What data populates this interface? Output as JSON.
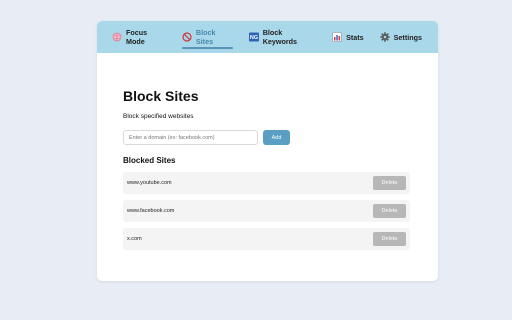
{
  "nav": {
    "tabs": [
      {
        "label": "Focus Mode",
        "icon": "brain-icon"
      },
      {
        "label": "Block Sites",
        "icon": "block-icon",
        "active": true
      },
      {
        "label": "Block Keywords",
        "icon": "ng-icon"
      },
      {
        "label": "Stats",
        "icon": "bar-chart-icon"
      },
      {
        "label": "Settings",
        "icon": "gear-icon"
      }
    ]
  },
  "main": {
    "title": "Block Sites",
    "subtitle": "Block specified websites",
    "input_placeholder": "Enter a domain (ex: facebook.com)",
    "add_label": "Add",
    "list_title": "Blocked Sites",
    "sites": [
      {
        "domain": "www.youtube.com",
        "delete_label": "Delete"
      },
      {
        "domain": "www.facebook.com",
        "delete_label": "Delete"
      },
      {
        "domain": "x.com",
        "delete_label": "Delete"
      }
    ]
  },
  "colors": {
    "page_bg": "#e8ecf4",
    "nav_bg": "#a8d8ea",
    "accent": "#5a9fc3",
    "block_icon": "#d0353f",
    "delete_btn": "#b7b7b7"
  }
}
